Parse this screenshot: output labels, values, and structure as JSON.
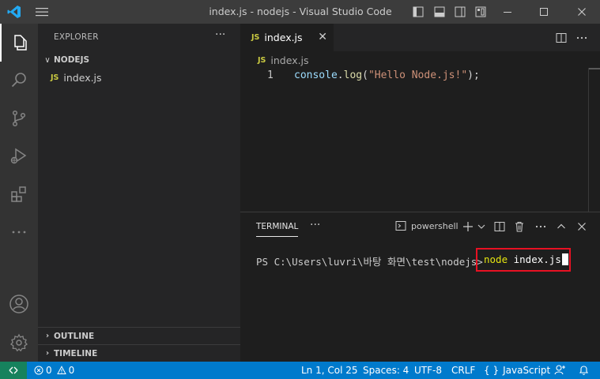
{
  "window": {
    "title": "index.js - nodejs - Visual Studio Code"
  },
  "sidebar": {
    "header": "EXPLORER",
    "more": "···",
    "folder": "NODEJS",
    "files": [
      {
        "badge": "JS",
        "name": "index.js",
        "icon": "javascript-file-icon"
      }
    ],
    "sections": [
      "OUTLINE",
      "TIMELINE"
    ]
  },
  "activity_bar": [
    "explorer-icon",
    "search-icon",
    "source-control-icon",
    "run-debug-icon",
    "extensions-icon",
    "more-icon",
    "account-icon",
    "settings-gear-icon"
  ],
  "editor": {
    "tab": {
      "badge": "JS",
      "label": "index.js",
      "close": "✕"
    },
    "breadcrumb": {
      "badge": "JS",
      "label": "index.js"
    },
    "lines": [
      {
        "number": "1",
        "object": "console",
        "dot": ".",
        "method": "log",
        "open": "(",
        "string": "\"Hello Node.js!\"",
        "close": ");"
      }
    ]
  },
  "panel": {
    "tab": "TERMINAL",
    "more": "···",
    "shell": "powershell",
    "prompt": "PS C:\\Users\\luvri\\바탕 화면\\test\\nodejs> ",
    "command_name": "node",
    "command_args": " index.js"
  },
  "status_bar": {
    "errors": "0",
    "warnings": "0",
    "cursor_position": "Ln 1, Col 25",
    "indentation": "Spaces: 4",
    "encoding": "UTF-8",
    "line_ending": "CRLF",
    "braces": "{ }",
    "language": "JavaScript"
  },
  "colors": {
    "title_bar": "#3c3c3c",
    "activity_bar": "#333333",
    "sidebar": "#252526",
    "editor": "#1e1e1e",
    "status_bar": "#007acc",
    "remote_indicator": "#16825d",
    "highlight_box": "#e81123",
    "js_badge": "#cbcb41"
  }
}
